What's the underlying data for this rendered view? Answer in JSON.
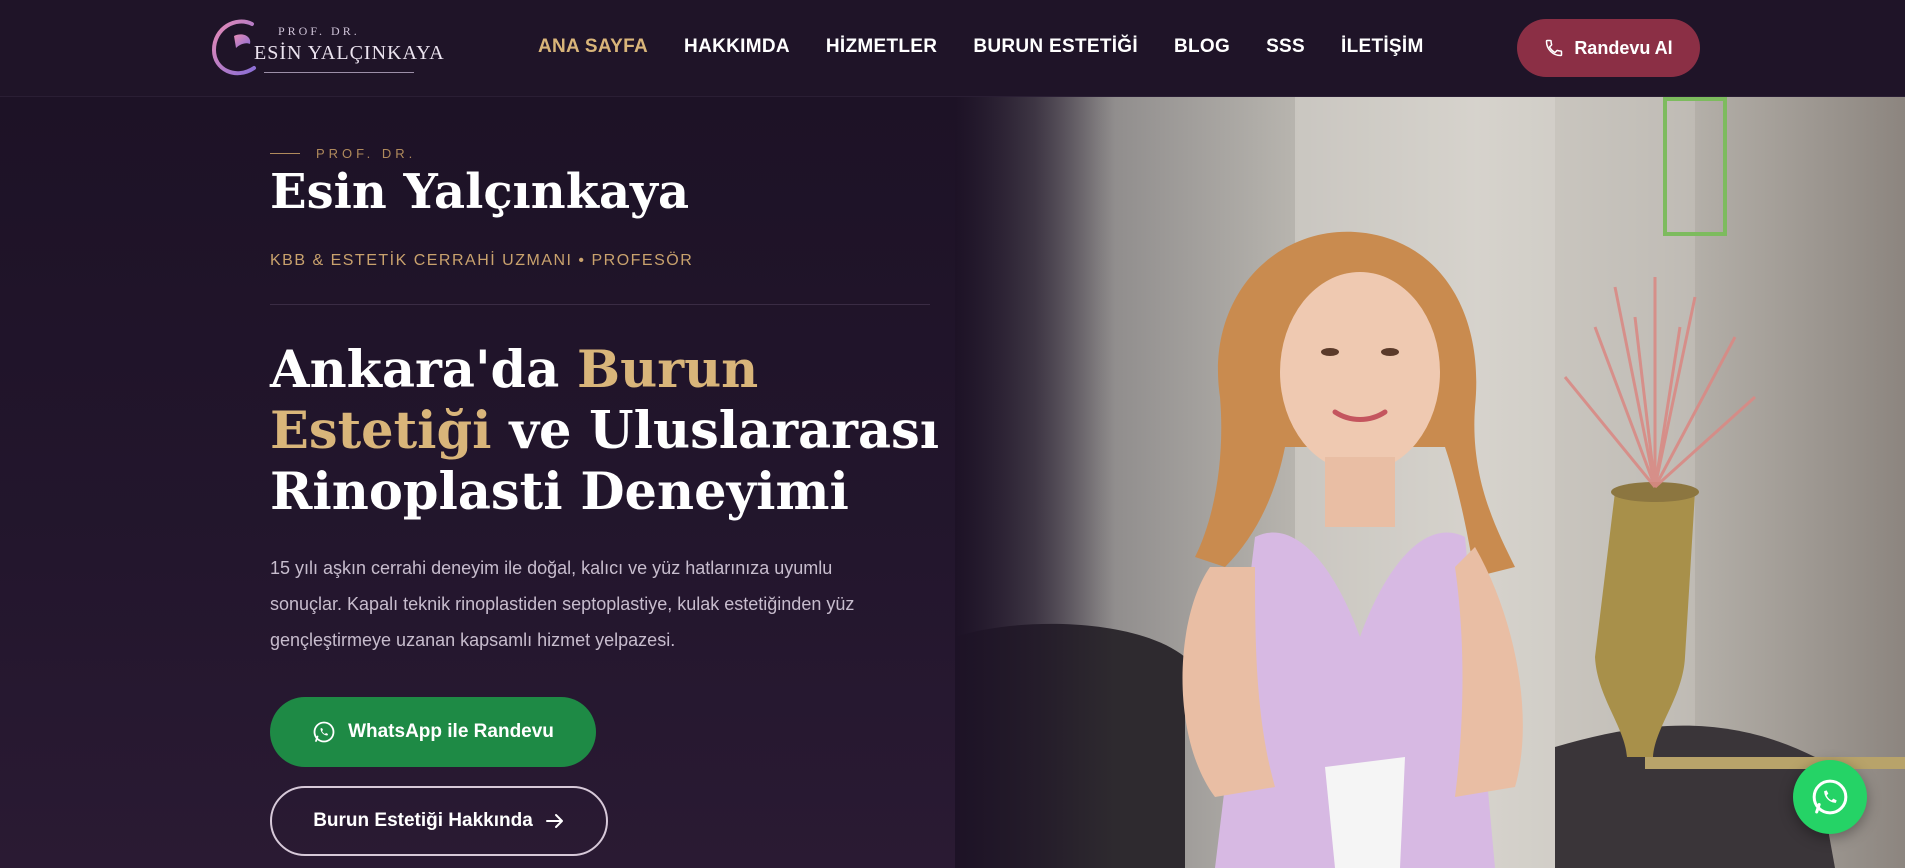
{
  "logo": {
    "prefix": "PROF. DR.",
    "name": "ESİN YALÇINKAYA"
  },
  "nav": {
    "items": [
      "ANA SAYFA",
      "HAKKIMDA",
      "HİZMETLER",
      "BURUN ESTETİĞİ",
      "BLOG",
      "SSS",
      "İLETİŞİM"
    ],
    "active_index": 0
  },
  "header": {
    "cta_label": "Randevu Al"
  },
  "hero": {
    "eyebrow": "PROF. DR.",
    "name": "Esin Yalçınkaya",
    "specialty": "KBB & ESTETİK CERRAHİ UZMANI • PROFESÖR",
    "headline_part1": "Ankara'da ",
    "headline_accent": "Burun Estetiği",
    "headline_part2": " ve Uluslararası Rinoplasti Deneyimi",
    "description": "15 yılı aşkın cerrahi deneyim ile doğal, kalıcı ve yüz hatlarınıza uyumlu sonuçlar. Kapalı teknik rinoplastiden septoplastiye, kulak estetiğinden yüz gençleştirmeye uzanan kapsamlı hizmet yelpazesi.",
    "whatsapp_button": "WhatsApp ile Randevu",
    "secondary_button": "Burun Estetiği Hakkında"
  },
  "colors": {
    "background": "#1d1226",
    "accent_gold": "#d9b57a",
    "cta_burgundy": "#8b2f45",
    "whatsapp_green": "#1e8a45",
    "fab_green": "#25d366"
  },
  "icons": {
    "header_cta": "phone-icon",
    "whatsapp_button": "whatsapp-icon",
    "secondary_button": "arrow-right-icon",
    "fab": "whatsapp-icon"
  }
}
